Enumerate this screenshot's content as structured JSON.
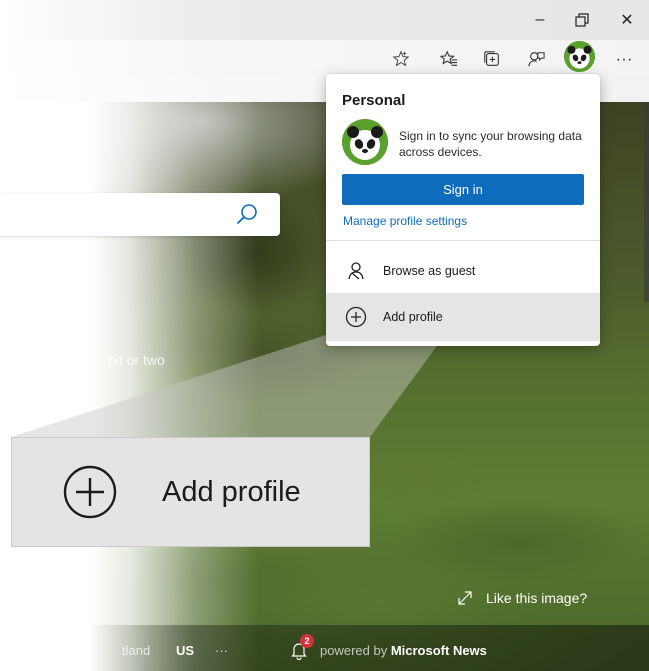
{
  "window": {
    "minimize_glyph": "–",
    "restore_glyph": "⧉",
    "close_glyph": "✕"
  },
  "toolbar": {
    "icons": [
      "star-icon",
      "favorites-icon",
      "collections-icon",
      "feedback-icon",
      "profile-avatar",
      "more-icon"
    ],
    "more_label": "···"
  },
  "page": {
    "search_placeholder": "",
    "partial_text": "bit or two"
  },
  "profile_menu": {
    "title": "Personal",
    "description": "Sign in to sync your browsing data across devices.",
    "sign_in_label": "Sign in",
    "manage_link": "Manage profile settings",
    "browse_as_guest": "Browse as guest",
    "add_profile": "Add profile"
  },
  "callout": {
    "label": "Add profile"
  },
  "image_credit": {
    "like_label": "Like this image?"
  },
  "bottom_bar": {
    "location": "tland",
    "region": "US",
    "more": "···",
    "notification_count": "2",
    "powered_prefix": "powered by ",
    "powered_brand": "Microsoft News"
  },
  "colors": {
    "accent": "#0f6cbd",
    "avatar_green": "#5aa02c",
    "badge_red": "#d13438"
  }
}
